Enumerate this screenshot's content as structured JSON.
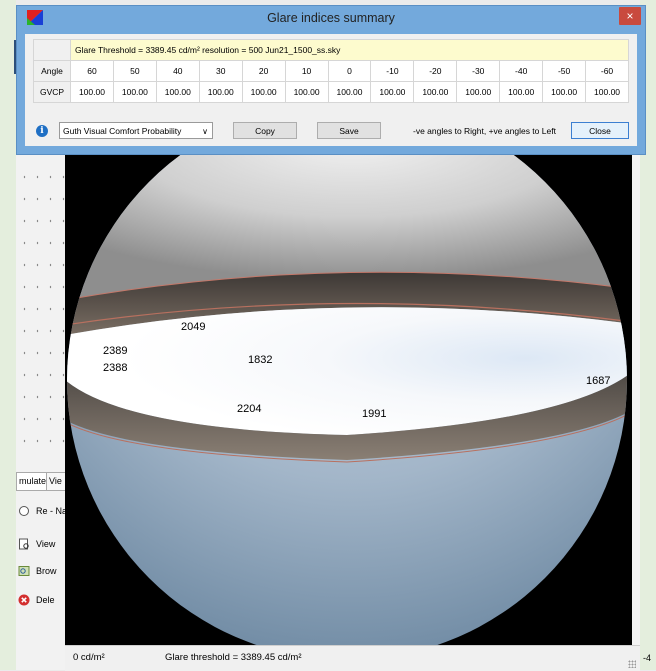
{
  "dialog": {
    "title": "Glare indices summary",
    "close_glyph": "×",
    "info_row": "Glare Threshold = 3389.45 cd/m²     resolution = 500     Jun21_1500_ss.sky",
    "angle_label": "Angle",
    "gvcp_label": "GVCP",
    "angles": [
      "60",
      "50",
      "40",
      "30",
      "20",
      "10",
      "0",
      "-10",
      "-20",
      "-30",
      "-40",
      "-50",
      "-60"
    ],
    "gvcp_values": [
      "100.00",
      "100.00",
      "100.00",
      "100.00",
      "100.00",
      "100.00",
      "100.00",
      "100.00",
      "100.00",
      "100.00",
      "100.00",
      "100.00",
      "100.00"
    ],
    "info_glyph": "i",
    "method_select": "Guth Visual Comfort Probability",
    "copy_label": "Copy",
    "save_label": "Save",
    "angle_note": "-ve angles to Right, +ve angles to Left",
    "close_label": "Close"
  },
  "viewer": {
    "luminance_labels": [
      "2049",
      "2389",
      "2388",
      "1832",
      "1687",
      "2204",
      "1991"
    ]
  },
  "statusbar": {
    "min_luminance": "0 cd/m²",
    "threshold": "Glare threshold = 3389.45 cd/m²",
    "edge_text": "-4"
  },
  "sidepanel": {
    "tabs": [
      "mulate",
      "Vie"
    ],
    "items": [
      {
        "label": "Re - Na",
        "icon": "radio-icon"
      },
      {
        "label": "View",
        "icon": "view-icon"
      },
      {
        "label": "Brow",
        "icon": "browse-icon"
      },
      {
        "label": "Dele",
        "icon": "delete-icon"
      }
    ]
  },
  "colors": {
    "dialog_frame": "#73a9dc",
    "close_red": "#c94a3e",
    "info_row_bg": "#fdfbce",
    "delete_red": "#d32f2f"
  }
}
